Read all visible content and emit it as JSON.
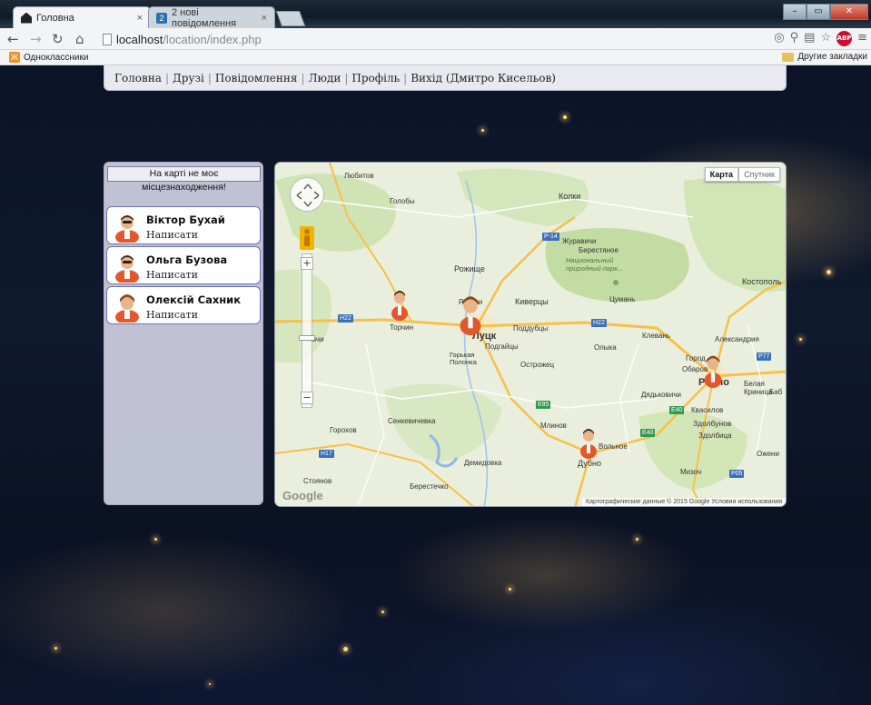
{
  "browser": {
    "tabs": [
      {
        "title": "Головна",
        "active": true
      },
      {
        "title": "2 нові повідомлення",
        "active": false,
        "badge": "2"
      }
    ],
    "close_glyph": "×",
    "address": {
      "host": "localhost",
      "path": "/location/index.php"
    },
    "bookmarks": {
      "left": "Одноклассники",
      "right": "Другие закладки"
    },
    "window_controls": [
      "–",
      "▭",
      "✕"
    ],
    "abp_label": "ABP"
  },
  "nav": {
    "items": [
      "Головна",
      "Друзі",
      "Повідомлення",
      "Люди",
      "Профіль",
      "Вихід (Дмитро Кисельов)"
    ]
  },
  "panel": {
    "no_location_text": "На карті не моє місцезнаходження!",
    "users": [
      {
        "name": "Віктор Бухай",
        "action": "Написати"
      },
      {
        "name": "Ольга Бузова",
        "action": "Написати"
      },
      {
        "name": "Олексій Сахник",
        "action": "Написати"
      }
    ]
  },
  "map": {
    "type_buttons": {
      "map": "Карта",
      "satellite": "Спутник"
    },
    "zoom_in": "+",
    "zoom_out": "−",
    "labels": {
      "lyubitov": "Любитов",
      "golobi": "Голобы",
      "kolki": "Колки",
      "zhuravichi": "Журавичи",
      "berestyanoe": "Берестяное",
      "park": "Национальный природный парк...",
      "rozhishche": "Рожище",
      "kostopol": "Костополь",
      "rokini": "Рокини",
      "kivertsy": "Киверцы",
      "tsuman": "Цумань",
      "torchin": "Торчин",
      "lutsk": "Луцк",
      "poddubtsy": "Поддубцы",
      "klevan": "Клевань",
      "aleksandriya": "Александрия",
      "podgaytsy": "Подгайцы",
      "olyka": "Олыка",
      "gorka": "Горькая Полонка",
      "ostrozhets": "Острожец",
      "obarov": "Обаров",
      "rovno": "Ровно",
      "gorod": "Город",
      "belaya": "Белая Криница",
      "dyadkovichi": "Дядьковичи",
      "kvasilov": "Квасилов",
      "senkevichevka": "Сенкевичевка",
      "mlinov": "Млинов",
      "zdolbunov": "Здолбунов",
      "zdolbitsa": "Здолбица",
      "gorokhov": "Горохов",
      "volnoe": "Вольное",
      "demidovka": "Демидовка",
      "dubno": "Дубно",
      "mizoch": "Мизоч",
      "stoyanov": "Стоянов",
      "berestechko": "Берестечко",
      "kachi": "Качи",
      "oscheni": "Ожени",
      "bab": "Баб"
    },
    "highways": {
      "p14": "P-14",
      "h22a": "H22",
      "h22b": "H22",
      "p77": "P77",
      "e85": "E85",
      "e40a": "E40",
      "e40b": "E40",
      "h17": "H17",
      "p05": "P05"
    },
    "attribution": "Картографические данные © 2015 Google   Условия использования",
    "google": "Google"
  },
  "colors": {
    "nav_bg": "#e9eaf0",
    "panel_bg": "#cdd0e1",
    "user_border": "#6d72b8",
    "avatar_shirt": "#e2572b"
  }
}
